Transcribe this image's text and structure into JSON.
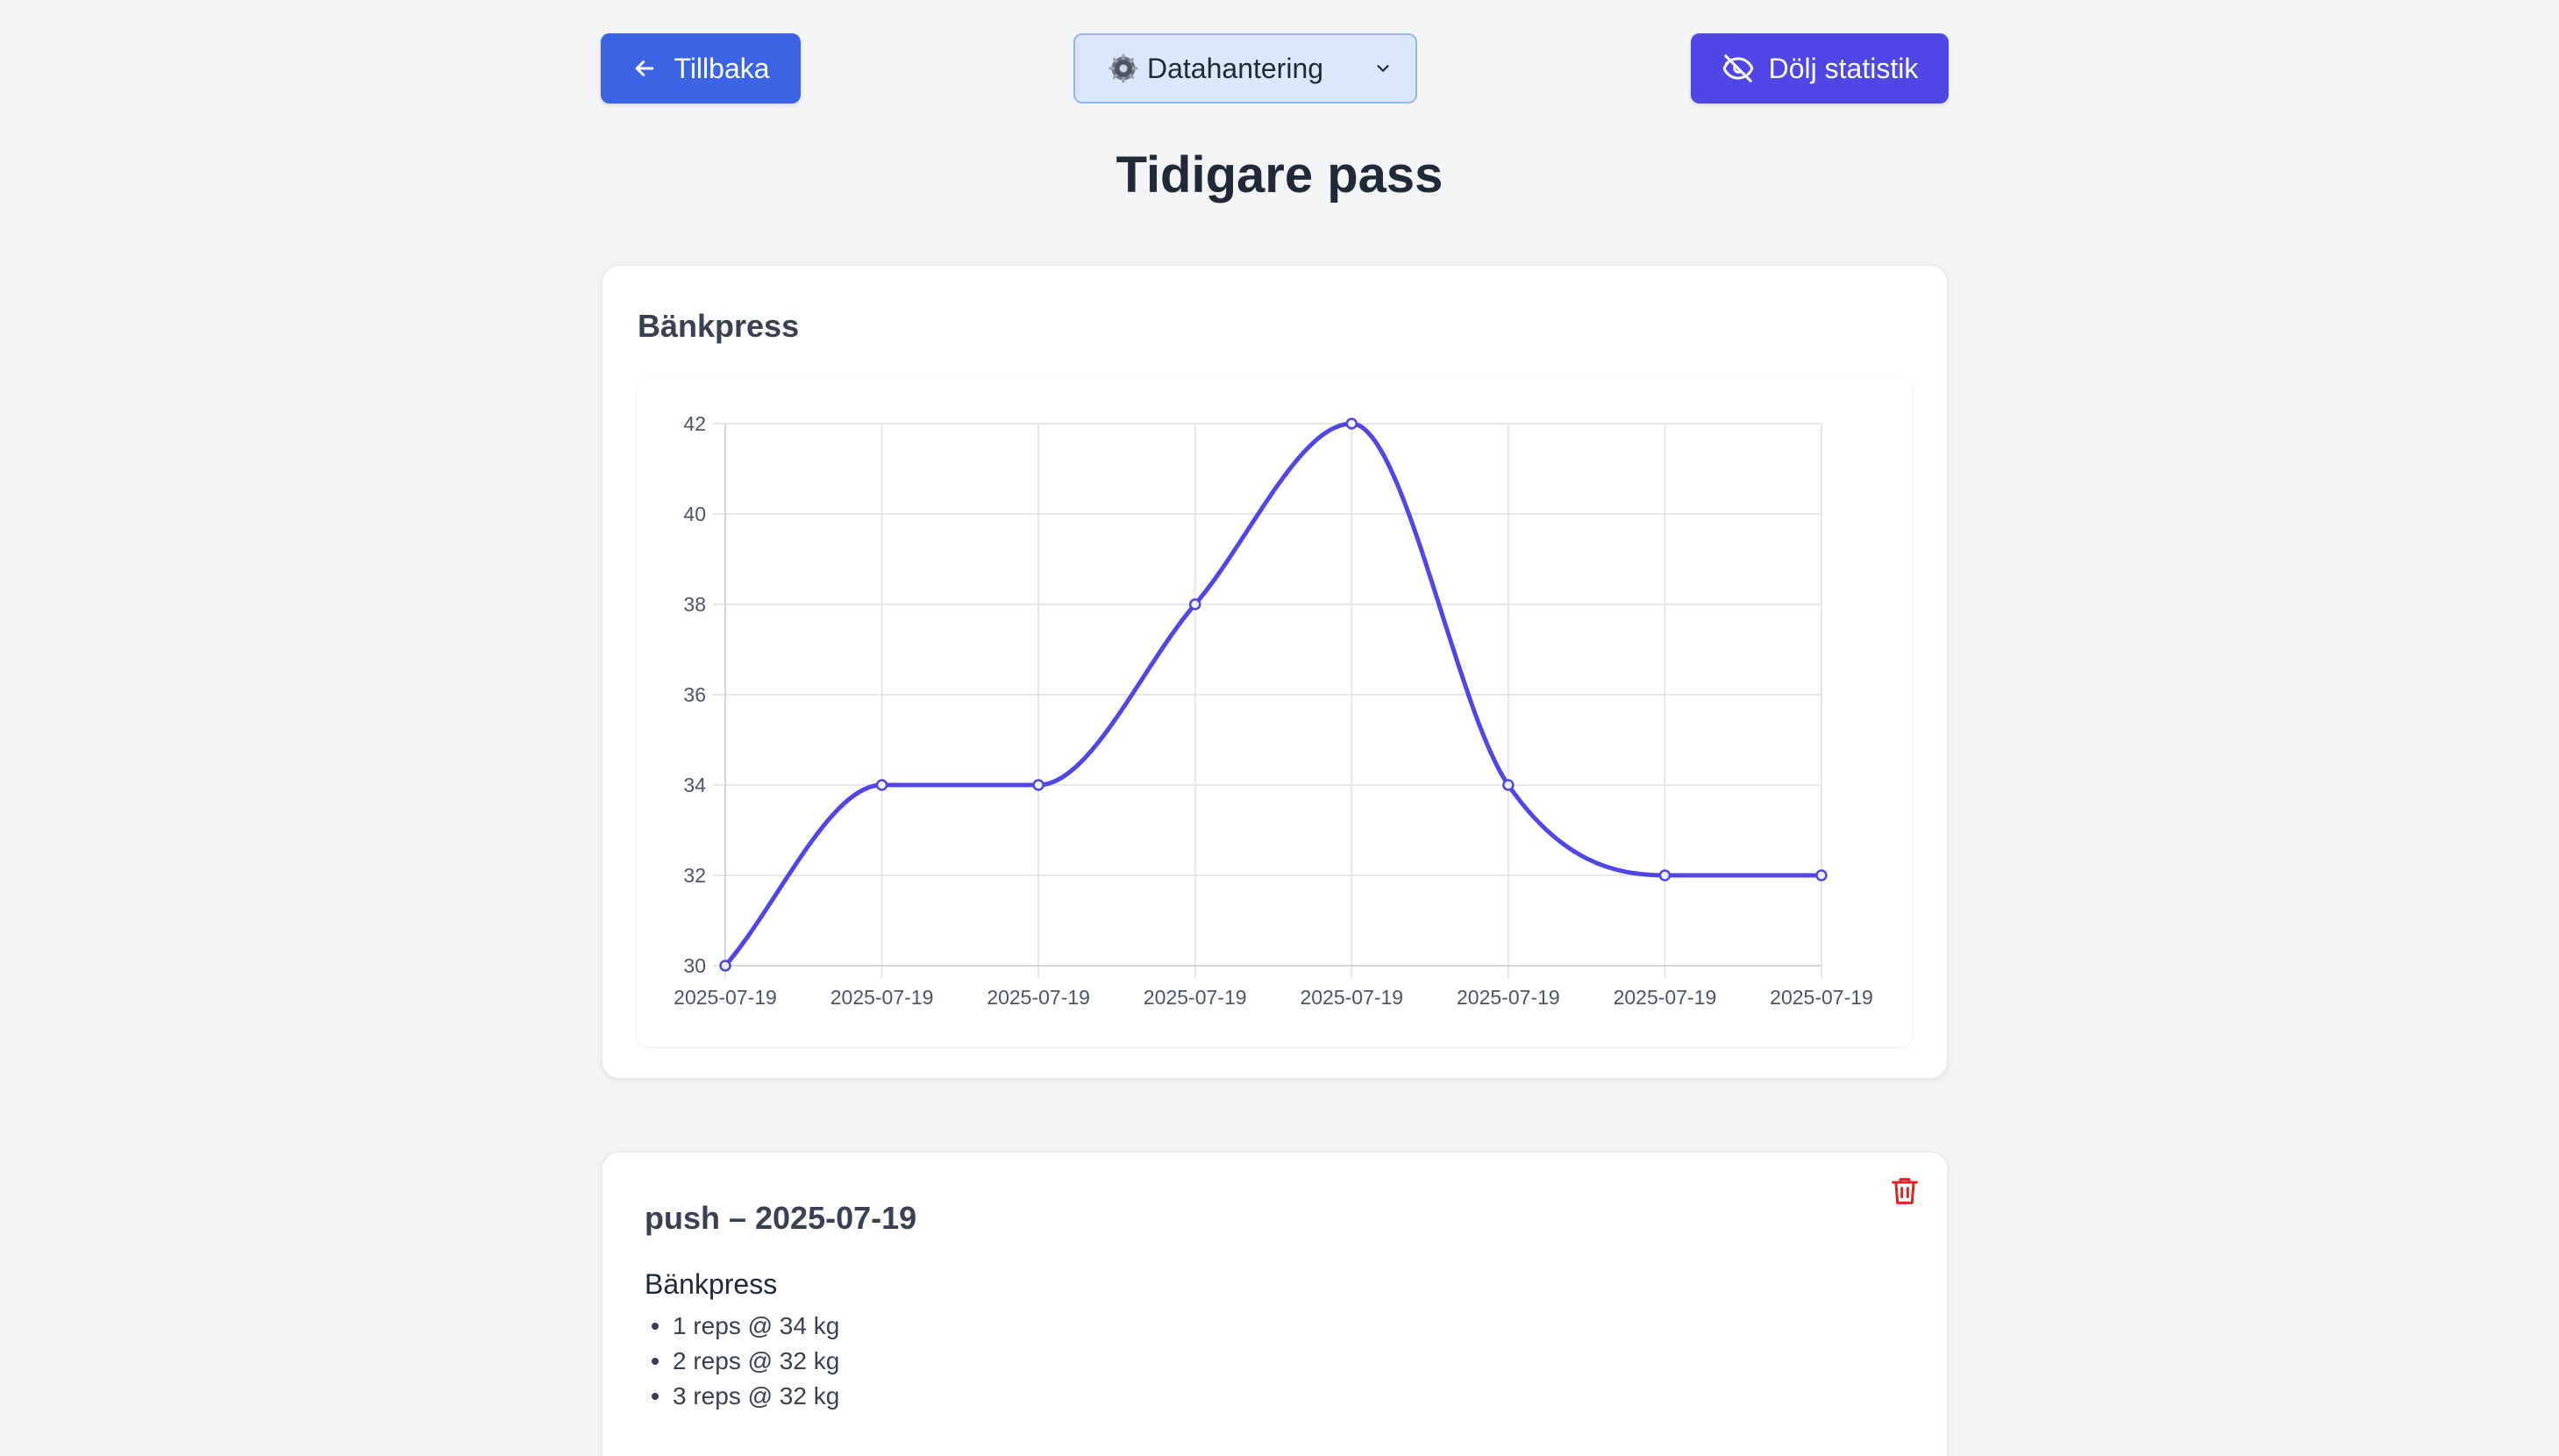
{
  "nav": {
    "back_label": "Tillbaka",
    "data_select_value": "Datahantering",
    "hide_stats_label": "Dölj statistik"
  },
  "page_title": "Tidigare pass",
  "colors": {
    "back_button": "#3b63e6",
    "hide_button": "#4f46e5",
    "line": "#4f46e5",
    "delete": "#dc2626"
  },
  "icons": {
    "back": "arrow-left-icon",
    "select": "gear-icon",
    "hide": "eye-off-icon",
    "delete": "trash-icon"
  },
  "chart_data": {
    "type": "line",
    "title": "Bänkpress",
    "categories": [
      "2025-07-19",
      "2025-07-19",
      "2025-07-19",
      "2025-07-19",
      "2025-07-19",
      "2025-07-19",
      "2025-07-19",
      "2025-07-19"
    ],
    "series": [
      {
        "values": [
          30,
          34,
          34,
          38,
          42,
          34,
          32,
          32
        ]
      }
    ],
    "yticks": [
      30,
      32,
      34,
      36,
      38,
      40,
      42
    ],
    "ylim": [
      30,
      42
    ],
    "grid": true,
    "smooth": true
  },
  "session": {
    "title": "push – 2025-07-19",
    "exercise": "Bänkpress",
    "sets": [
      "1 reps @ 34 kg",
      "2 reps @ 32 kg",
      "3 reps @ 32 kg"
    ]
  }
}
